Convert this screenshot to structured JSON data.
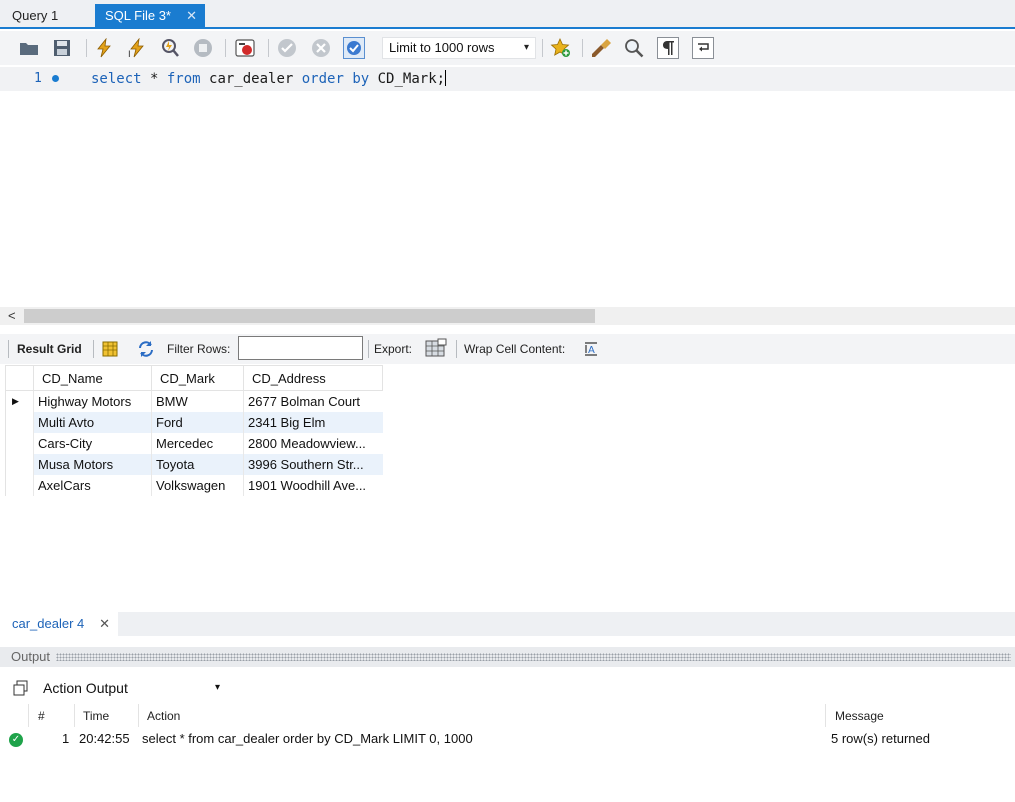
{
  "tabs": {
    "query1": "Query 1",
    "sqlfile": "SQL File 3*",
    "close": "✕"
  },
  "toolbar": {
    "icons": [
      "open-folder-icon",
      "save-icon",
      "execute-icon",
      "execute-current-icon",
      "explain-icon",
      "stop-icon",
      "toggle-errors-icon",
      "commit-icon",
      "rollback-icon",
      "autocommit-icon",
      "bookmark-icon",
      "beautify-icon",
      "find-icon",
      "invisible-chars-icon",
      "wrap-icon"
    ],
    "limit_label": "Limit to 1000 rows",
    "limit_caret": "▾"
  },
  "editor": {
    "line_number": "1",
    "code": {
      "kw_select": "select",
      "star": " * ",
      "kw_from": "from",
      "table": " car_dealer ",
      "kw_order": "order",
      "space": " ",
      "kw_by": "by",
      "rest": " CD_Mark;"
    }
  },
  "scroll": {
    "left_arrow": "<"
  },
  "result_toolbar": {
    "result_grid": "Result Grid",
    "filter_rows": "Filter Rows:",
    "filter_value": "",
    "export": "Export:",
    "wrap": "Wrap Cell Content:"
  },
  "grid": {
    "columns": [
      "CD_Name",
      "CD_Mark",
      "CD_Address"
    ],
    "rows": [
      [
        "Highway Motors",
        "BMW",
        "2677 Bolman Court"
      ],
      [
        "Multi Avto",
        "Ford",
        "2341 Big Elm"
      ],
      [
        "Cars-City",
        "Mercedec",
        "2800 Meadowview..."
      ],
      [
        "Musa Motors",
        "Toyota",
        "3996 Southern Str..."
      ],
      [
        "AxelCars",
        "Volkswagen",
        "1901 Woodhill Ave..."
      ]
    ],
    "row_marker": "▶"
  },
  "result_tabs": {
    "tab": "car_dealer 4",
    "close": "✕"
  },
  "output": {
    "title": "Output",
    "selector": "Action Output",
    "caret": "▾",
    "columns": {
      "num": "#",
      "time": "Time",
      "action": "Action",
      "message": "Message"
    },
    "rows": [
      {
        "num": "1",
        "time": "20:42:55",
        "action": "select * from car_dealer order by CD_Mark LIMIT 0, 1000",
        "message": "5 row(s) returned"
      }
    ]
  },
  "colors": {
    "accent": "#1a7cd0",
    "keyword": "#1d63b8",
    "alt_row": "#eaf2fb",
    "ok": "#1fa34a"
  }
}
